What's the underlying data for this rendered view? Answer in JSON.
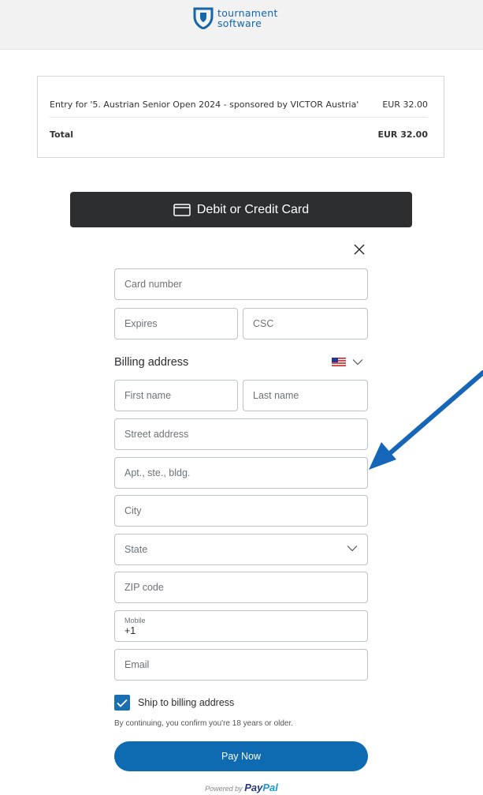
{
  "header": {
    "logo_line1": "tournament",
    "logo_line2": "software"
  },
  "summary": {
    "entry_label": "Entry for '5. Austrian Senior Open 2024 - sponsored by VICTOR Austria'",
    "entry_amount": "EUR 32.00",
    "total_label": "Total",
    "total_amount": "EUR 32.00"
  },
  "card_button": {
    "label": "Debit or Credit Card"
  },
  "form": {
    "card_number": "Card number",
    "expires": "Expires",
    "csc": "CSC",
    "billing_label": "Billing address",
    "first_name": "First name",
    "last_name": "Last name",
    "street": "Street address",
    "apt": "Apt., ste., bldg.",
    "city": "City",
    "state": "State",
    "zip": "ZIP code",
    "mobile_label": "Mobile",
    "mobile_value": "+1",
    "email": "Email",
    "ship_label": "Ship to billing address",
    "ship_checked": true,
    "disclaimer": "By continuing, you confirm you're 18 years or older.",
    "pay_label": "Pay Now"
  },
  "footer": {
    "powered_by": "Powered by",
    "brand_pay": "Pay",
    "brand_pal": "Pal"
  },
  "colors": {
    "accent": "#0e6bb1",
    "dark_button": "#2c2e2f",
    "arrow": "#1565b8"
  }
}
